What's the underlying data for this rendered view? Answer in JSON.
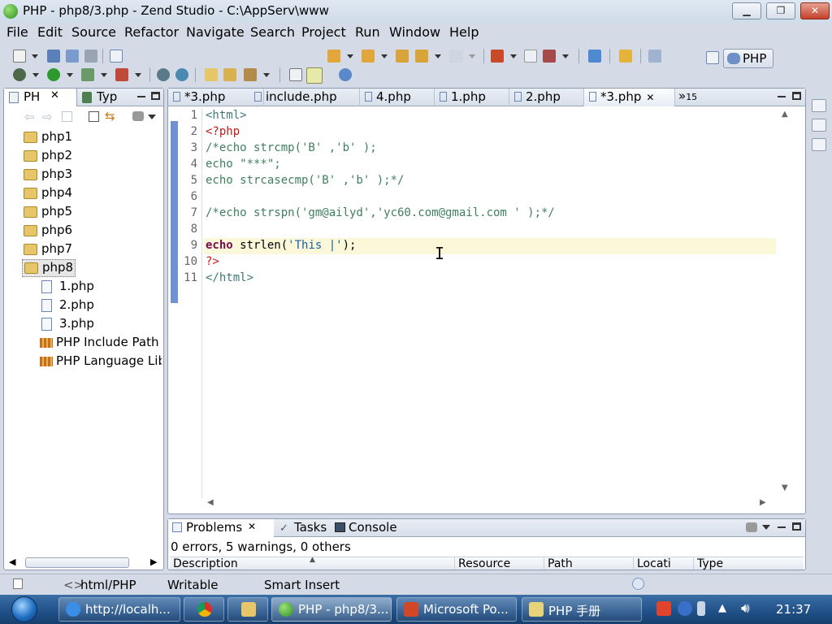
{
  "window": {
    "title": "PHP - php8/3.php - Zend Studio - C:\\AppServ\\www",
    "minimize_glyph": "▁",
    "maximize_glyph": "❐",
    "close_glyph": "✕"
  },
  "menu": [
    "File",
    "Edit",
    "Source",
    "Refactor",
    "Navigate",
    "Search",
    "Project",
    "Run",
    "Window",
    "Help"
  ],
  "perspective": {
    "label": "PHP"
  },
  "left_panel": {
    "tabs": [
      {
        "label": "PH",
        "close": "✕"
      },
      {
        "label": "Typ"
      }
    ],
    "tree": [
      {
        "label": "php1",
        "type": "folder"
      },
      {
        "label": "php2",
        "type": "folder"
      },
      {
        "label": "php3",
        "type": "folder"
      },
      {
        "label": "php4",
        "type": "folder"
      },
      {
        "label": "php5",
        "type": "folder"
      },
      {
        "label": "php6",
        "type": "folder"
      },
      {
        "label": "php7",
        "type": "folder"
      },
      {
        "label": "php8",
        "type": "folder",
        "selected": true
      },
      {
        "label": "1.php",
        "type": "file"
      },
      {
        "label": "2.php",
        "type": "file"
      },
      {
        "label": "3.php",
        "type": "file"
      },
      {
        "label": "PHP Include Path",
        "type": "library"
      },
      {
        "label": "PHP Language Lib",
        "type": "library"
      }
    ]
  },
  "editor": {
    "tabs": [
      {
        "label": "*3.php"
      },
      {
        "label": "include.php"
      },
      {
        "label": "4.php"
      },
      {
        "label": "1.php"
      },
      {
        "label": "2.php"
      },
      {
        "label": "*3.php",
        "active": true,
        "close": "✕"
      }
    ],
    "overflow": {
      "chevron": "»",
      "count": "15"
    },
    "lines": [
      {
        "no": "1",
        "segments": [
          {
            "t": "<html>",
            "c": "tag"
          }
        ]
      },
      {
        "no": "2",
        "segments": [
          {
            "t": "<?php",
            "c": "php"
          }
        ]
      },
      {
        "no": "3",
        "segments": [
          {
            "t": "/*echo strcmp('B' ,'b' );",
            "c": "cmt"
          }
        ]
      },
      {
        "no": "4",
        "segments": [
          {
            "t": "echo \"***\";",
            "c": "cmt"
          }
        ]
      },
      {
        "no": "5",
        "segments": [
          {
            "t": "echo strcasecmp('B' ,'b' );*/",
            "c": "cmt"
          }
        ]
      },
      {
        "no": "6",
        "segments": []
      },
      {
        "no": "7",
        "segments": [
          {
            "t": "/*echo strspn('gm@ailyd','yc60.com@gmail.com ' );*/",
            "c": "cmt"
          }
        ]
      },
      {
        "no": "8",
        "segments": []
      },
      {
        "no": "9",
        "current": true,
        "segments": [
          {
            "t": "echo",
            "c": "kw"
          },
          {
            "t": " strlen(",
            "c": "def"
          },
          {
            "t": "'This |'",
            "c": "str"
          },
          {
            "t": ");",
            "c": "def"
          }
        ]
      },
      {
        "no": "10",
        "segments": [
          {
            "t": "?>",
            "c": "php"
          }
        ]
      },
      {
        "no": "11",
        "segments": [
          {
            "t": "</html>",
            "c": "tag"
          }
        ]
      }
    ]
  },
  "bottom_panel": {
    "tabs": [
      {
        "label": "Problems",
        "close": "✕"
      },
      {
        "label": "Tasks"
      },
      {
        "label": "Console"
      }
    ],
    "summary": "0 errors, 5 warnings, 0 others",
    "columns": [
      "Description",
      "Resource",
      "Path",
      "Locati",
      "Type"
    ]
  },
  "status_bar": {
    "content_type": "html/PHP",
    "content_type_glyph": "<>",
    "write_mode": "Writable",
    "insert_mode": "Smart Insert"
  },
  "taskbar": {
    "items": [
      {
        "label": "http://localh...",
        "icon": "ie-icon"
      },
      {
        "label": "",
        "icon": "chrome-icon"
      },
      {
        "label": "",
        "icon": "folder-icon"
      },
      {
        "label": "PHP - php8/3...",
        "icon": "zend-icon",
        "active": true
      },
      {
        "label": "Microsoft Po...",
        "icon": "powerpoint-icon"
      },
      {
        "label": "PHP 手册",
        "icon": "help-file-icon"
      }
    ],
    "clock": "21:37"
  },
  "colors": {
    "accent": "#6f90d2",
    "current_line": "#fbf8d9",
    "taskbar": "#1f4f86"
  }
}
